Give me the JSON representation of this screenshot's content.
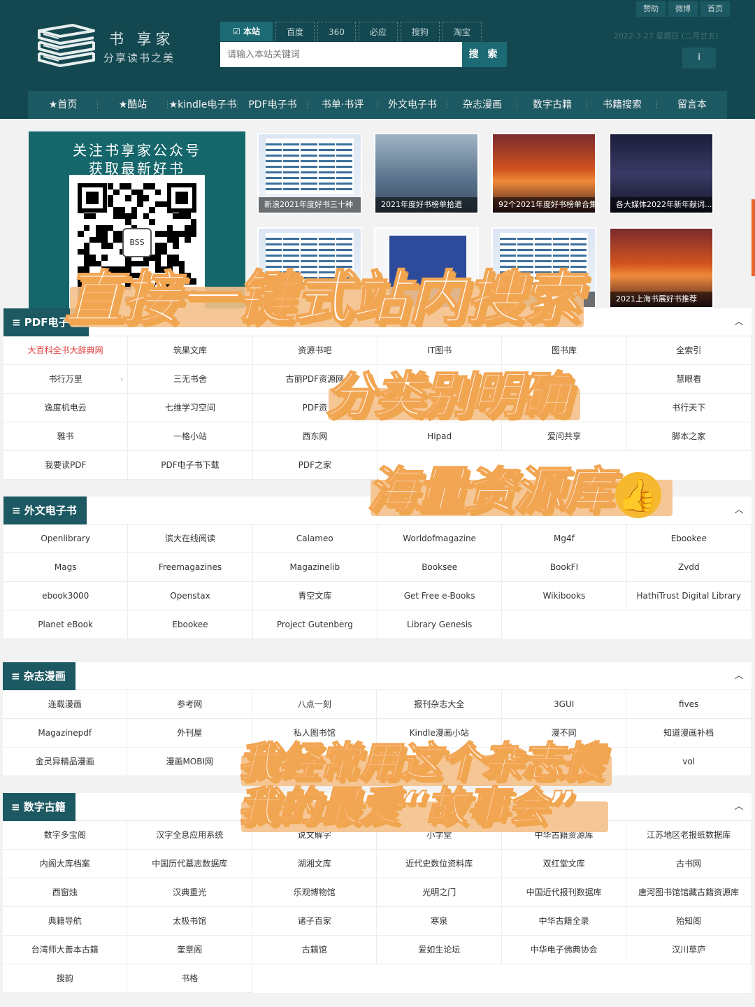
{
  "header": {
    "top_links": [
      "赞助",
      "微博",
      "首页"
    ],
    "logo_name": "书 享家",
    "logo_slogan": "分享读书之美",
    "engine_tabs": [
      "本站",
      "百度",
      "360",
      "必应",
      "搜狗",
      "淘宝"
    ],
    "search_placeholder": "请输入本站关键词",
    "search_button": "搜 索",
    "date": "2022-3-27  星期日 (二月廿五)",
    "info_icon": "i"
  },
  "nav": {
    "items": [
      "★首页",
      "★酷站",
      "★kindle电子书",
      "PDF电子书",
      "书单·书评",
      "外文电子书",
      "杂志漫画",
      "数字古籍",
      "书籍搜索",
      "留言本"
    ]
  },
  "promo": {
    "title_line1": "关注书享家公众号",
    "title_line2": "获取最新好书",
    "qr_logo": "BSS"
  },
  "thumbnails": [
    {
      "caption": "新浪2021年度好书三十种",
      "theme": "table"
    },
    {
      "caption": "2021年度好书榜单拾遗",
      "theme": "rain"
    },
    {
      "caption": "92个2021年度好书榜单合集",
      "theme": "sunset"
    },
    {
      "caption": "各大媒体2022年新年献词...",
      "theme": "night"
    },
    {
      "caption": "",
      "theme": "table"
    },
    {
      "caption": "",
      "theme": "book"
    },
    {
      "caption": "合集",
      "theme": "table"
    },
    {
      "caption": "2021上海书展好书推荐",
      "theme": "sunset"
    }
  ],
  "sections": [
    {
      "title": "≡ PDF电子书",
      "items": [
        "大百科全书大辞典网",
        "筑果文库",
        "资源书吧",
        "IT图书",
        "图书库",
        "全索引",
        "书行万里",
        "三无书舍",
        "古丽PDF资源网",
        "",
        "",
        "慧眼看",
        "逸度机电云",
        "七维学习空间",
        "PDF资",
        "",
        "馆",
        "书行天下",
        "雅书",
        "一格小站",
        "西东网",
        "Hipad",
        "爱问共享",
        "脚本之家",
        "我要读PDF",
        "PDF电子书下载",
        "PDF之家"
      ]
    },
    {
      "title": "≡ 外文电子书",
      "items": [
        "Openlibrary",
        "滨大在线阅读",
        "Calameo",
        "Worldofmagazine",
        "Mg4f",
        "Ebookee",
        "Mags",
        "Freemagazines",
        "Magazinelib",
        "Booksee",
        "BookFI",
        "Zvdd",
        "ebook3000",
        "Openstax",
        "青空文库",
        "Get Free e-Books",
        "Wikibooks",
        "HathiTrust Digital Library",
        "Planet eBook",
        "Ebookee",
        "Project Gutenberg",
        "Library Genesis"
      ]
    },
    {
      "title": "≡ 杂志漫画",
      "items": [
        "连载漫画",
        "参考网",
        "八点一刻",
        "报刊杂志大全",
        "3GUI",
        "fives",
        "Magazinepdf",
        "外刊屋",
        "私人图书馆",
        "Kindle漫画小站",
        "漫不同",
        "知道漫画补档",
        "金灵异精品漫画",
        "漫画MOBI网",
        "",
        "",
        "",
        "vol"
      ]
    },
    {
      "title": "≡ 数字古籍",
      "items": [
        "数字多宝阁",
        "汉字全息应用系统",
        "说文解字",
        "小学堂",
        "中华古籍资源库",
        "江苏地区老报纸数据库",
        "内阁大库档案",
        "中国历代墓志数据库",
        "湖湘文库",
        "近代史数位资料库",
        "双红堂文库",
        "古书网",
        "西窗烛",
        "汉典重光",
        "乐观博物馆",
        "光明之门",
        "中国近代报刊数据库",
        "唐河图书馆馆藏古籍资源库",
        "典籍导航",
        "太极书馆",
        "诸子百家",
        "寒泉",
        "中华古籍全录",
        "殆知阁",
        "台湾师大善本古籍",
        "奎章阁",
        "古籍馆",
        "爱如生论坛",
        "中华电子佛典协会",
        "汉川草庐",
        "搜韵",
        "书格"
      ]
    }
  ],
  "overlays": [
    "直接一键式站内搜索",
    "分类别明确",
    "海量资源库",
    "我经常用这个杂志搜",
    "我的最爱“故事会”"
  ],
  "colors": {
    "header_bg": "#144850",
    "nav_bg": "#1d5962",
    "accent": "#1b6a74",
    "overlay_orange": "#f0a64e",
    "highlight_red": "#e04040"
  }
}
